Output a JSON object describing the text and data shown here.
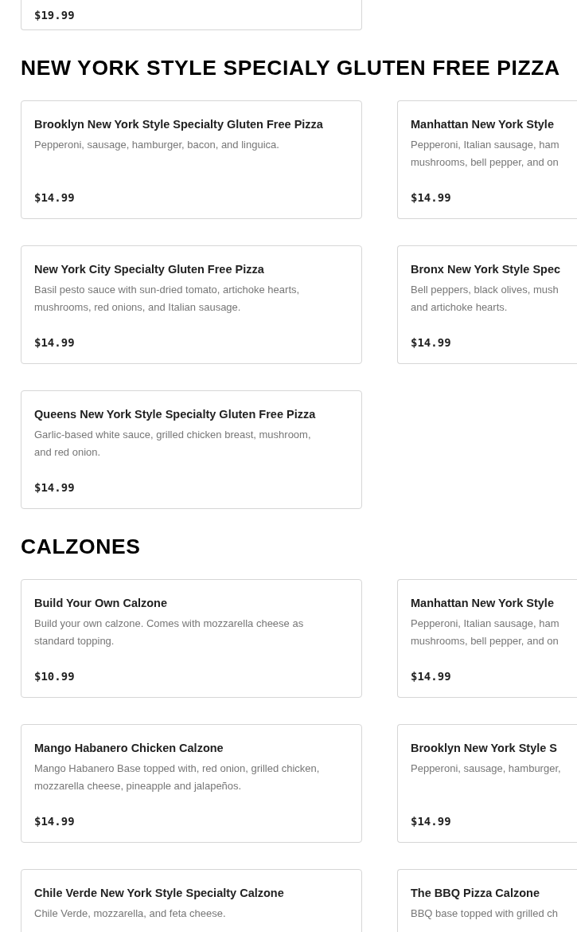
{
  "top_partial_card": {
    "price": "$19.99"
  },
  "sections": [
    {
      "heading": "NEW YORK STYLE SPECIALY GLUTEN FREE PIZZA",
      "items": [
        {
          "title": "Brooklyn New York Style Specialty Gluten Free Pizza",
          "description_lines": [
            "Pepperoni, sausage, hamburger, bacon, and linguica."
          ],
          "price": "$14.99"
        },
        {
          "title": "Manhattan New York Style",
          "description_lines": [
            "Pepperoni, Italian sausage, ham",
            "mushrooms, bell pepper, and on"
          ],
          "price": "$14.99"
        },
        {
          "title": "New York City Specialty Gluten Free Pizza",
          "description_lines": [
            "Basil pesto sauce with sun-dried tomato, artichoke hearts,",
            "mushrooms, red onions, and Italian sausage."
          ],
          "price": "$14.99"
        },
        {
          "title": "Bronx New York Style Spec",
          "description_lines": [
            "Bell peppers, black olives, mush",
            "and artichoke hearts."
          ],
          "price": "$14.99"
        },
        {
          "title": "Queens New York Style Specialty Gluten Free Pizza",
          "description_lines": [
            "Garlic-based white sauce, grilled chicken breast, mushroom,",
            "and red onion."
          ],
          "price": "$14.99"
        }
      ]
    },
    {
      "heading": "CALZONES",
      "items": [
        {
          "title": "Build Your Own Calzone",
          "description_lines": [
            "Build your own calzone. Comes with mozzarella cheese as",
            "standard topping."
          ],
          "price": "$10.99"
        },
        {
          "title": "Manhattan New York Style",
          "description_lines": [
            "Pepperoni, Italian sausage, ham",
            "mushrooms, bell pepper, and on"
          ],
          "price": "$14.99"
        },
        {
          "title": "Mango Habanero Chicken Calzone",
          "description_lines": [
            "Mango Habanero Base topped with, red onion, grilled chicken,",
            "mozzarella cheese, pineapple and jalapeños."
          ],
          "price": "$14.99"
        },
        {
          "title": "Brooklyn New York Style S",
          "description_lines": [
            "Pepperoni, sausage, hamburger,"
          ],
          "price": "$14.99"
        },
        {
          "title": "Chile Verde New York Style Specialty Calzone",
          "description_lines": [
            "Chile Verde, mozzarella, and feta cheese."
          ]
        },
        {
          "title": "The BBQ Pizza Calzone",
          "description_lines": [
            "BBQ base topped with grilled ch"
          ]
        }
      ]
    }
  ]
}
